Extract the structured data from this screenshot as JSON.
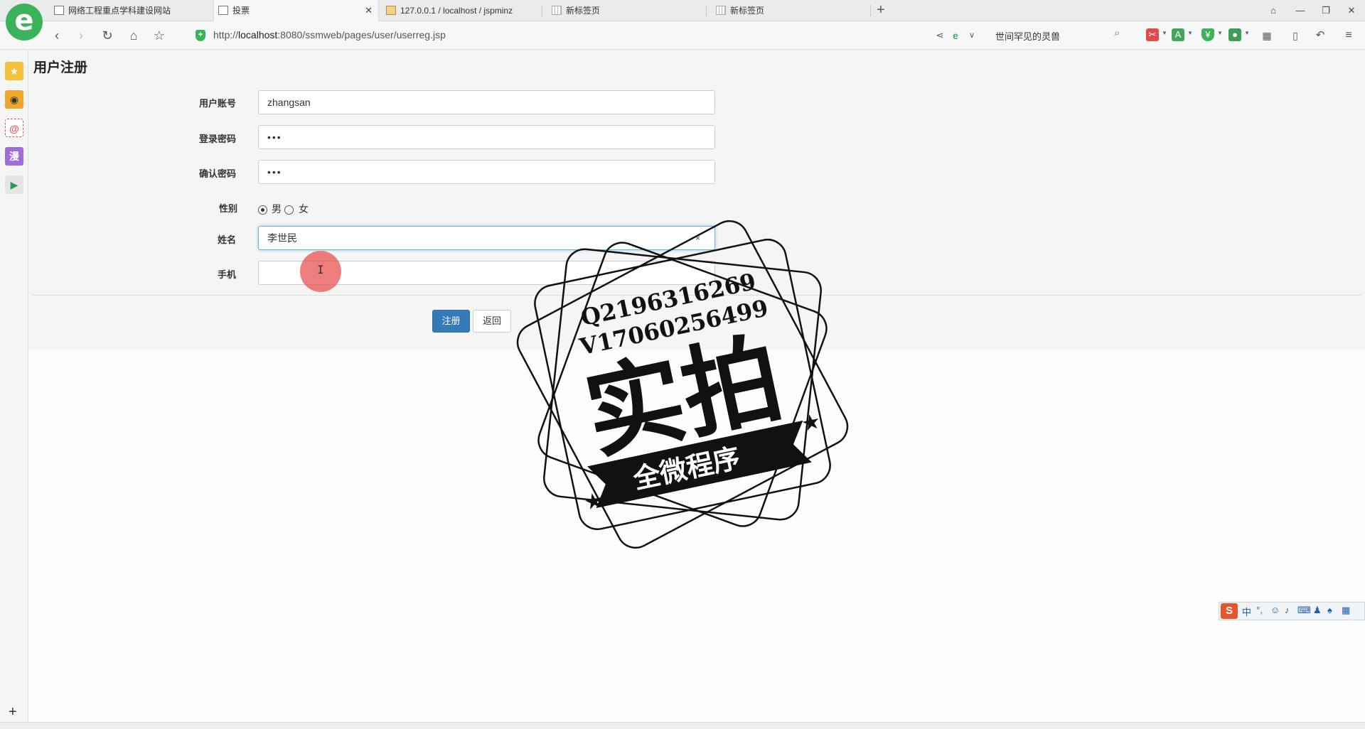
{
  "browser": {
    "tabs": [
      {
        "label": "网络工程重点学科建设网站",
        "active": false
      },
      {
        "label": "投票",
        "active": true
      },
      {
        "label": "127.0.0.1 / localhost / jspminz",
        "active": false
      },
      {
        "label": "新标签页",
        "active": false
      },
      {
        "label": "新标签页",
        "active": false
      }
    ],
    "new_tab_glyph": "+",
    "url_prefix": "http://",
    "url_host": "localhost",
    "url_path": ":8080/ssmweb/pages/user/userreg.jsp",
    "search_text": "世间罕见的灵兽",
    "logo_letter": "e"
  },
  "page": {
    "title": "用户注册",
    "fields": {
      "account": {
        "label": "用户账号",
        "value": "zhangsan"
      },
      "password": {
        "label": "登录密码",
        "value": "•••"
      },
      "confirm": {
        "label": "确认密码",
        "value": "•••"
      },
      "gender": {
        "label": "性别",
        "options": [
          "男",
          "女"
        ],
        "selected": "男"
      },
      "name": {
        "label": "姓名",
        "value": "李世民",
        "clear": "×"
      },
      "phone": {
        "label": "手机",
        "value": ""
      }
    },
    "buttons": {
      "register": "注册",
      "back": "返回"
    }
  },
  "stamp": {
    "line1": "Q2196316269",
    "line2": "V17060256499",
    "big": "实拍",
    "banner": "全微程序"
  },
  "ime": {
    "logo": "S",
    "mode": "中"
  },
  "colors": {
    "primary": "#337ab7",
    "brand_green": "#3cb35b",
    "focus": "#66afe9"
  }
}
